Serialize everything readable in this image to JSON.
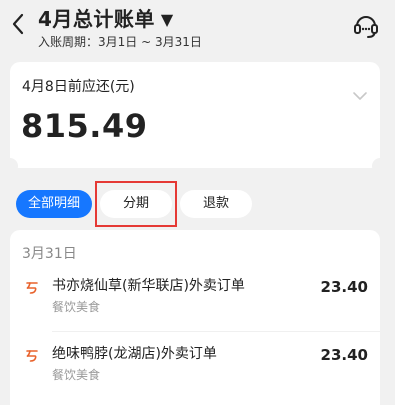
{
  "header": {
    "title": "4月总计账单",
    "caret_icon": "▼",
    "period": "入账周期：3月1日 ~ 3月31日",
    "back_icon": "chevron-left-icon",
    "service_icon": "headset-icon"
  },
  "summary": {
    "label": "4月8日前应还(元)",
    "amount": "815.49"
  },
  "filters": [
    {
      "label": "全部明细",
      "active": true
    },
    {
      "label": "分期",
      "active": false,
      "highlighted": true
    },
    {
      "label": "退款",
      "active": false
    }
  ],
  "transactions": {
    "date": "3月31日",
    "items": [
      {
        "title": "书亦烧仙草(新华联店)外卖订单",
        "category": "餐饮美食",
        "amount": "23.40"
      },
      {
        "title": "绝味鸭脖(龙湖店)外卖订单",
        "category": "餐饮美食",
        "amount": "23.40"
      }
    ]
  },
  "colors": {
    "accent": "#1677ff",
    "highlight": "#e53935",
    "dining_icon": "#e8622c",
    "background": "#f1f1f1"
  }
}
